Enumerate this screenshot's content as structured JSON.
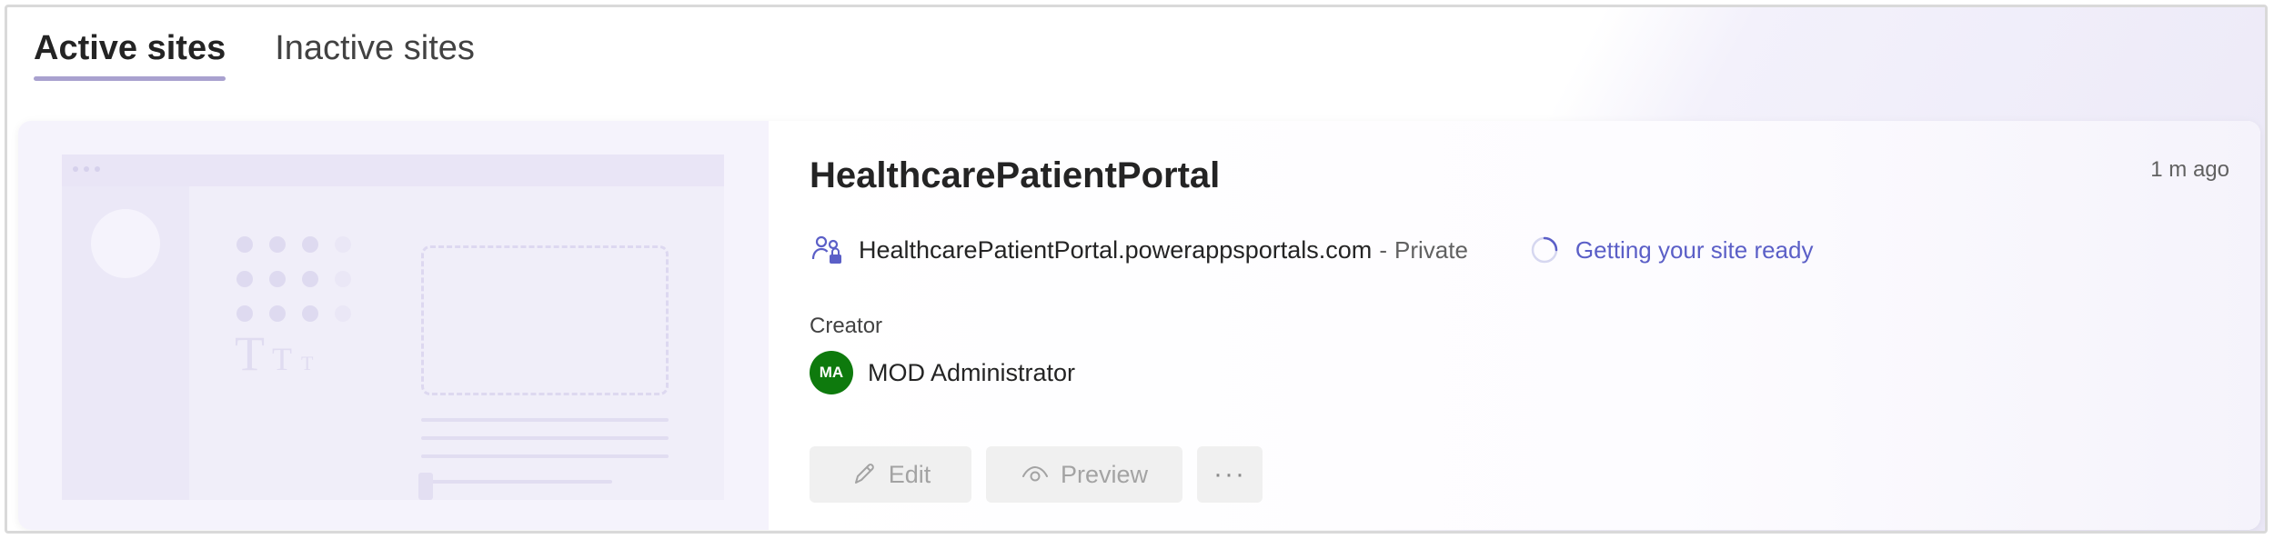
{
  "tabs": [
    {
      "label": "Active sites",
      "active": true
    },
    {
      "label": "Inactive sites",
      "active": false
    }
  ],
  "site": {
    "name": "HealthcarePatientPortal",
    "time_ago": "1 m ago",
    "url": "HealthcarePatientPortal.powerappsportals.com",
    "separator": "-",
    "visibility": "Private",
    "status": "Getting your site ready",
    "creator_label": "Creator",
    "creator_initials": "MA",
    "creator_name": "MOD Administrator"
  },
  "actions": {
    "edit_label": "Edit",
    "preview_label": "Preview",
    "more_label": "···"
  },
  "icons": {
    "visibility": "people-lock-icon",
    "status": "spinner-icon",
    "edit": "pencil-icon",
    "preview": "eye-icon"
  },
  "colors": {
    "accent": "#5b5fc7",
    "avatar": "#0e7a0d",
    "tab_underline": "#a9a1cf",
    "button_bg": "#f0f0f0"
  }
}
